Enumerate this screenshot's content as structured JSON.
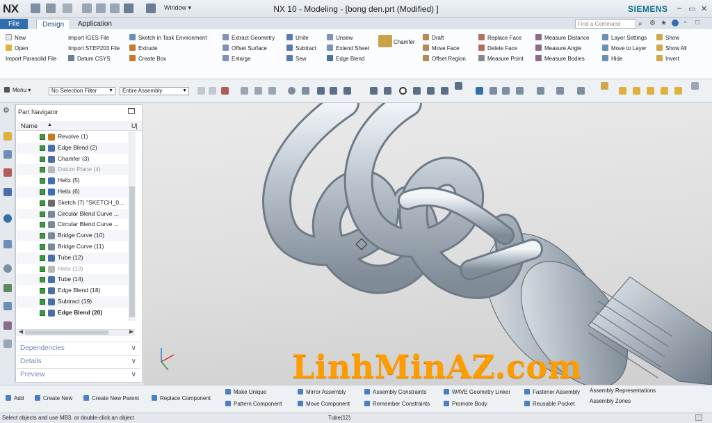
{
  "titlebar": {
    "logo": "NX",
    "window_menu": "Window ▾",
    "title": "NX 10 - Modeling - [bong den.prt (Modified) ]",
    "brand": "SIEMENS"
  },
  "tabs": {
    "file": "File",
    "design": "Design",
    "application": "Application"
  },
  "command_search": {
    "placeholder": "Find a Command"
  },
  "ribbon": {
    "col1": [
      "New",
      "Open",
      "Import Parasolid File"
    ],
    "col2": [
      "Import IGES File",
      "Import STEP203 File",
      "Datum CSYS"
    ],
    "col3": [
      "Sketch in Task Environment",
      "Extrude",
      "Create Box"
    ],
    "col4": [
      "Extract Geometry",
      "Offset Surface",
      "Enlarge"
    ],
    "col5": [
      "Unite",
      "Subtract",
      "Sew"
    ],
    "col6": [
      "Unsew",
      "Extend Sheet",
      "Edge Blend"
    ],
    "chamfer": "Chamfer",
    "col8": [
      "Draft",
      "Move Face",
      "Offset Region"
    ],
    "col9": [
      "Replace Face",
      "Delete Face",
      "Measure Point"
    ],
    "col10": [
      "Measure Distance",
      "Measure Angle",
      "Measure Bodies"
    ],
    "col11": [
      "Layer Settings",
      "Move to Layer",
      "Hide"
    ],
    "col12": [
      "Show",
      "Show All",
      "Invert"
    ]
  },
  "toolbar": {
    "menu": "Menu ▾",
    "filter": "No Selection Filter",
    "assembly": "Entire Assembly"
  },
  "navigator": {
    "title": "Part Navigator",
    "col_name": "Name",
    "col_up": "U|",
    "items": [
      {
        "label": "Revolve (1)",
        "state": "normal",
        "color": "#c47a1e"
      },
      {
        "label": "Edge Blend (2)",
        "state": "normal",
        "color": "#4a6fa8"
      },
      {
        "label": "Chamfer (3)",
        "state": "normal",
        "color": "#4a6fa8"
      },
      {
        "label": "Datum Plane (4)",
        "state": "dim",
        "color": "#b9b9b9"
      },
      {
        "label": "Helix (5)",
        "state": "normal",
        "color": "#3d6db8"
      },
      {
        "label": "Helix (6)",
        "state": "normal",
        "color": "#3d6db8"
      },
      {
        "label": "Sketch (7) \"SKETCH_0...",
        "state": "normal",
        "color": "#6b6b6b"
      },
      {
        "label": "Circular Blend Curve ...",
        "state": "normal",
        "color": "#7a8a9a"
      },
      {
        "label": "Circular Blend Curve ...",
        "state": "normal",
        "color": "#7a8a9a"
      },
      {
        "label": "Bridge Curve (10)",
        "state": "normal",
        "color": "#7a8a9a"
      },
      {
        "label": "Bridge Curve (11)",
        "state": "normal",
        "color": "#7a8a9a"
      },
      {
        "label": "Tube (12)",
        "state": "normal",
        "color": "#4a6fa8"
      },
      {
        "label": "Helix (13)",
        "state": "dim",
        "color": "#b9b9b9"
      },
      {
        "label": "Tube (14)",
        "state": "normal",
        "color": "#4a6fa8"
      },
      {
        "label": "Edge Blend (18)",
        "state": "normal",
        "color": "#4a6fa8"
      },
      {
        "label": "Subtract (19)",
        "state": "normal",
        "color": "#4a6fa8"
      },
      {
        "label": "Edge Blend (20)",
        "state": "bold",
        "color": "#4a6fa8"
      }
    ],
    "sections": [
      "Dependencies",
      "Details",
      "Preview"
    ]
  },
  "bottom": {
    "row1": [
      "Add",
      "Create New",
      "Create New Parent",
      "Replace Component",
      "Make Unique",
      "Mirror Assembly",
      "Assembly Constraints",
      "WAVE Geometry Linker",
      "Fastener Assembly",
      "Assembly Representations"
    ],
    "row2": [
      "Pattern Component",
      "Move Component",
      "Remember Constraints",
      "Promote Body",
      "Reusable Pocket",
      "Assembly Zones"
    ]
  },
  "status": {
    "left": "Select objects and use MB3, or double-click an object",
    "mid": "Tube(12)"
  },
  "watermark": "LinhMinAZ.com",
  "colors": {
    "accent": "#2f6fad",
    "watermark": "#ff9d00",
    "brand": "#0f6e87"
  }
}
